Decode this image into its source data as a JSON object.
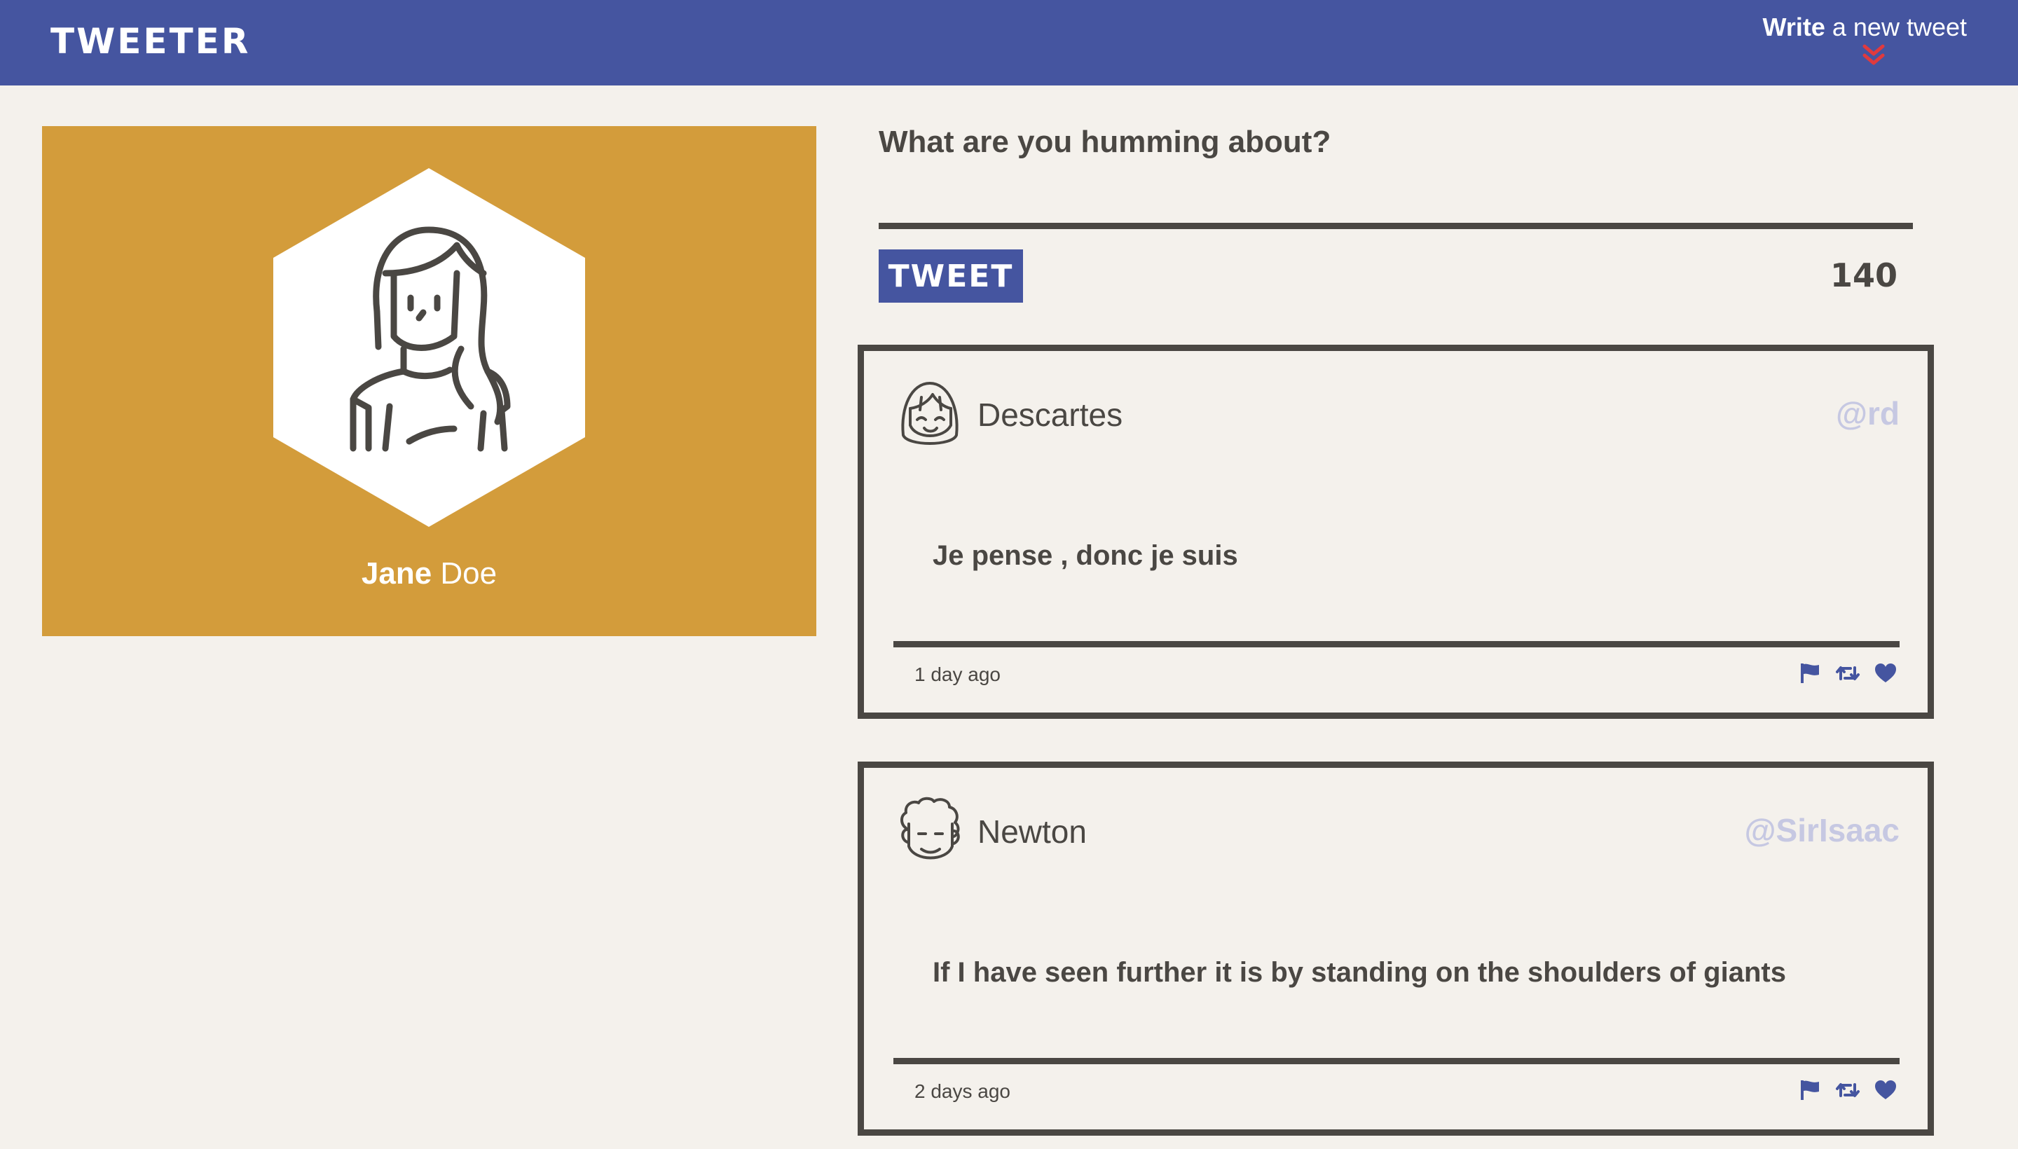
{
  "brand": "TWEETER",
  "nav": {
    "compose_bold": "Write",
    "compose_rest": " a new tweet"
  },
  "profile": {
    "first_name": "Jane",
    "last_name": " Doe"
  },
  "compose": {
    "prompt": "What are you humming about?",
    "value": "",
    "button": "TWEET",
    "counter": "140"
  },
  "tweets": [
    {
      "name": "Descartes",
      "handle": "@rd",
      "text": "Je pense , donc je suis",
      "time": "1 day ago"
    },
    {
      "name": "Newton",
      "handle": "@SirIsaac",
      "text": "If I have seen further it is by standing on the shoulders of giants",
      "time": "2 days ago"
    }
  ],
  "colors": {
    "nav": "#4555a0",
    "background": "#f4f1ec",
    "profile_card": "#d39c3b",
    "text": "#4a4743",
    "handle": "#c6c8e2",
    "action_icons": "#4555a0",
    "compose_chevron": "#e03a3e"
  },
  "icons": [
    "double-chevron-down-icon",
    "flag-icon",
    "retweet-icon",
    "heart-icon"
  ]
}
